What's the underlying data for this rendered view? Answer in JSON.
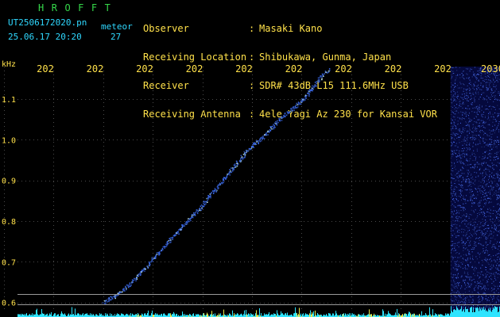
{
  "header": {
    "logo": "HROFFT",
    "filename": "UT2506172020.pn",
    "filename_suffix": "meteor",
    "datetime": "25.06.17 20:20",
    "count": "27",
    "meta": [
      {
        "key": "Observer",
        "value": "Masaki Kano"
      },
      {
        "key": "Receiving Location",
        "value": "Shibukawa, Gunma, Japan"
      },
      {
        "key": "Receiver",
        "value": "SDR# 43dB L15 111.6MHz USB"
      },
      {
        "key": "Receiving Antenna",
        "value": "4ele Yagi Az 230 for Kansai VOR"
      }
    ]
  },
  "colors": {
    "background": "#000000",
    "text_yellow": "#ffe14a",
    "text_cyan": "#2fd8ff",
    "logo_green": "#35d84a",
    "echo_blue": "#3a5cff",
    "grid": "#4a4a4a",
    "baseline_cyan": "#2ee4ff",
    "baseline_yellow": "#e8e84a"
  },
  "chart_data": {
    "type": "scatter",
    "ylabel": "kHz",
    "ylim": [
      0.58,
      1.18
    ],
    "yticks": [
      "1.1",
      "1.0",
      "0.9",
      "0.8",
      "0.7",
      "0.6"
    ],
    "ytick_values": [
      1.1,
      1.0,
      0.9,
      0.8,
      0.7,
      0.6
    ],
    "xtick_labels": [
      "202",
      "202",
      "202",
      "202",
      "202",
      "202",
      "202",
      "202",
      "202",
      "2030"
    ],
    "xlim": [
      0,
      10
    ],
    "series": [
      {
        "description": "meteor echo trace",
        "x": [
          2.0,
          2.4,
          2.8,
          3.2,
          3.6,
          4.0,
          4.3,
          4.6,
          4.9,
          5.2,
          5.5,
          5.8,
          6.1,
          6.35,
          6.55
        ],
        "y": [
          0.6,
          0.63,
          0.68,
          0.735,
          0.79,
          0.84,
          0.885,
          0.93,
          0.975,
          1.005,
          1.045,
          1.075,
          1.11,
          1.15,
          1.175
        ]
      }
    ],
    "noise_band_x": [
      9.0,
      10.0
    ],
    "reference_lines_y": [
      0.62,
      0.595
    ]
  }
}
